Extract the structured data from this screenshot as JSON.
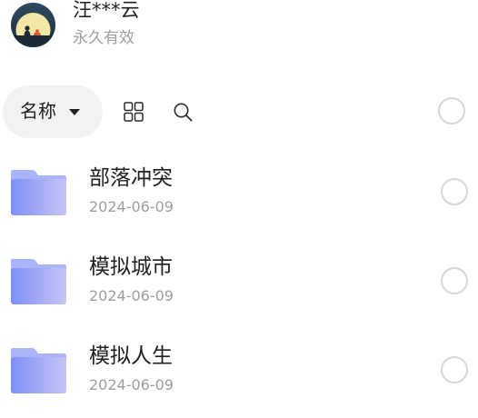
{
  "user": {
    "name": "汪***云",
    "status": "永久有效"
  },
  "toolbar": {
    "sort_label": "名称",
    "sort_caret": "caret-down-icon",
    "view_icon": "grid-view-icon",
    "search_icon": "search-icon",
    "select_icon": "circle-checkbox-icon"
  },
  "files": [
    {
      "name": "部落冲突",
      "date": "2024-06-09",
      "icon": "folder-icon"
    },
    {
      "name": "模拟城市",
      "date": "2024-06-09",
      "icon": "folder-icon"
    },
    {
      "name": "模拟人生",
      "date": "2024-06-09",
      "icon": "folder-icon"
    }
  ],
  "colors": {
    "text_primary": "#1f1f1f",
    "text_secondary": "#9e9e9e",
    "pill_bg": "#f2f2f2",
    "folder_front": "#8c9bf7",
    "folder_back": "#a7b4fb",
    "checkbox_border": "#d6d6d6"
  }
}
